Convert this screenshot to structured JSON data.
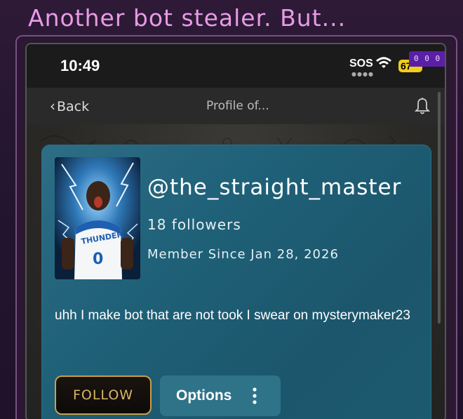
{
  "post": {
    "title": "Another bot stealer. But..."
  },
  "statusbar": {
    "time": "10:49",
    "sos": "SOS",
    "battery": "67",
    "overlay_badge": "0 0 0"
  },
  "navbar": {
    "back_label": "Back",
    "title": "Profile of..."
  },
  "profile": {
    "handle": "@the_straight_master",
    "followers": "18 followers",
    "member_since": "Member Since Jan 28, 2026",
    "bio": "uhh I make bot that are not took I swear on mysterymaker23",
    "follow_label": "FOLLOW",
    "options_label": "Options"
  },
  "colors": {
    "title_pink": "#e79be6",
    "card_teal": "#1f6178",
    "follow_gold": "#d9b665",
    "battery_yellow": "#f2cc1e",
    "badge_purple": "#5b1fa6"
  }
}
